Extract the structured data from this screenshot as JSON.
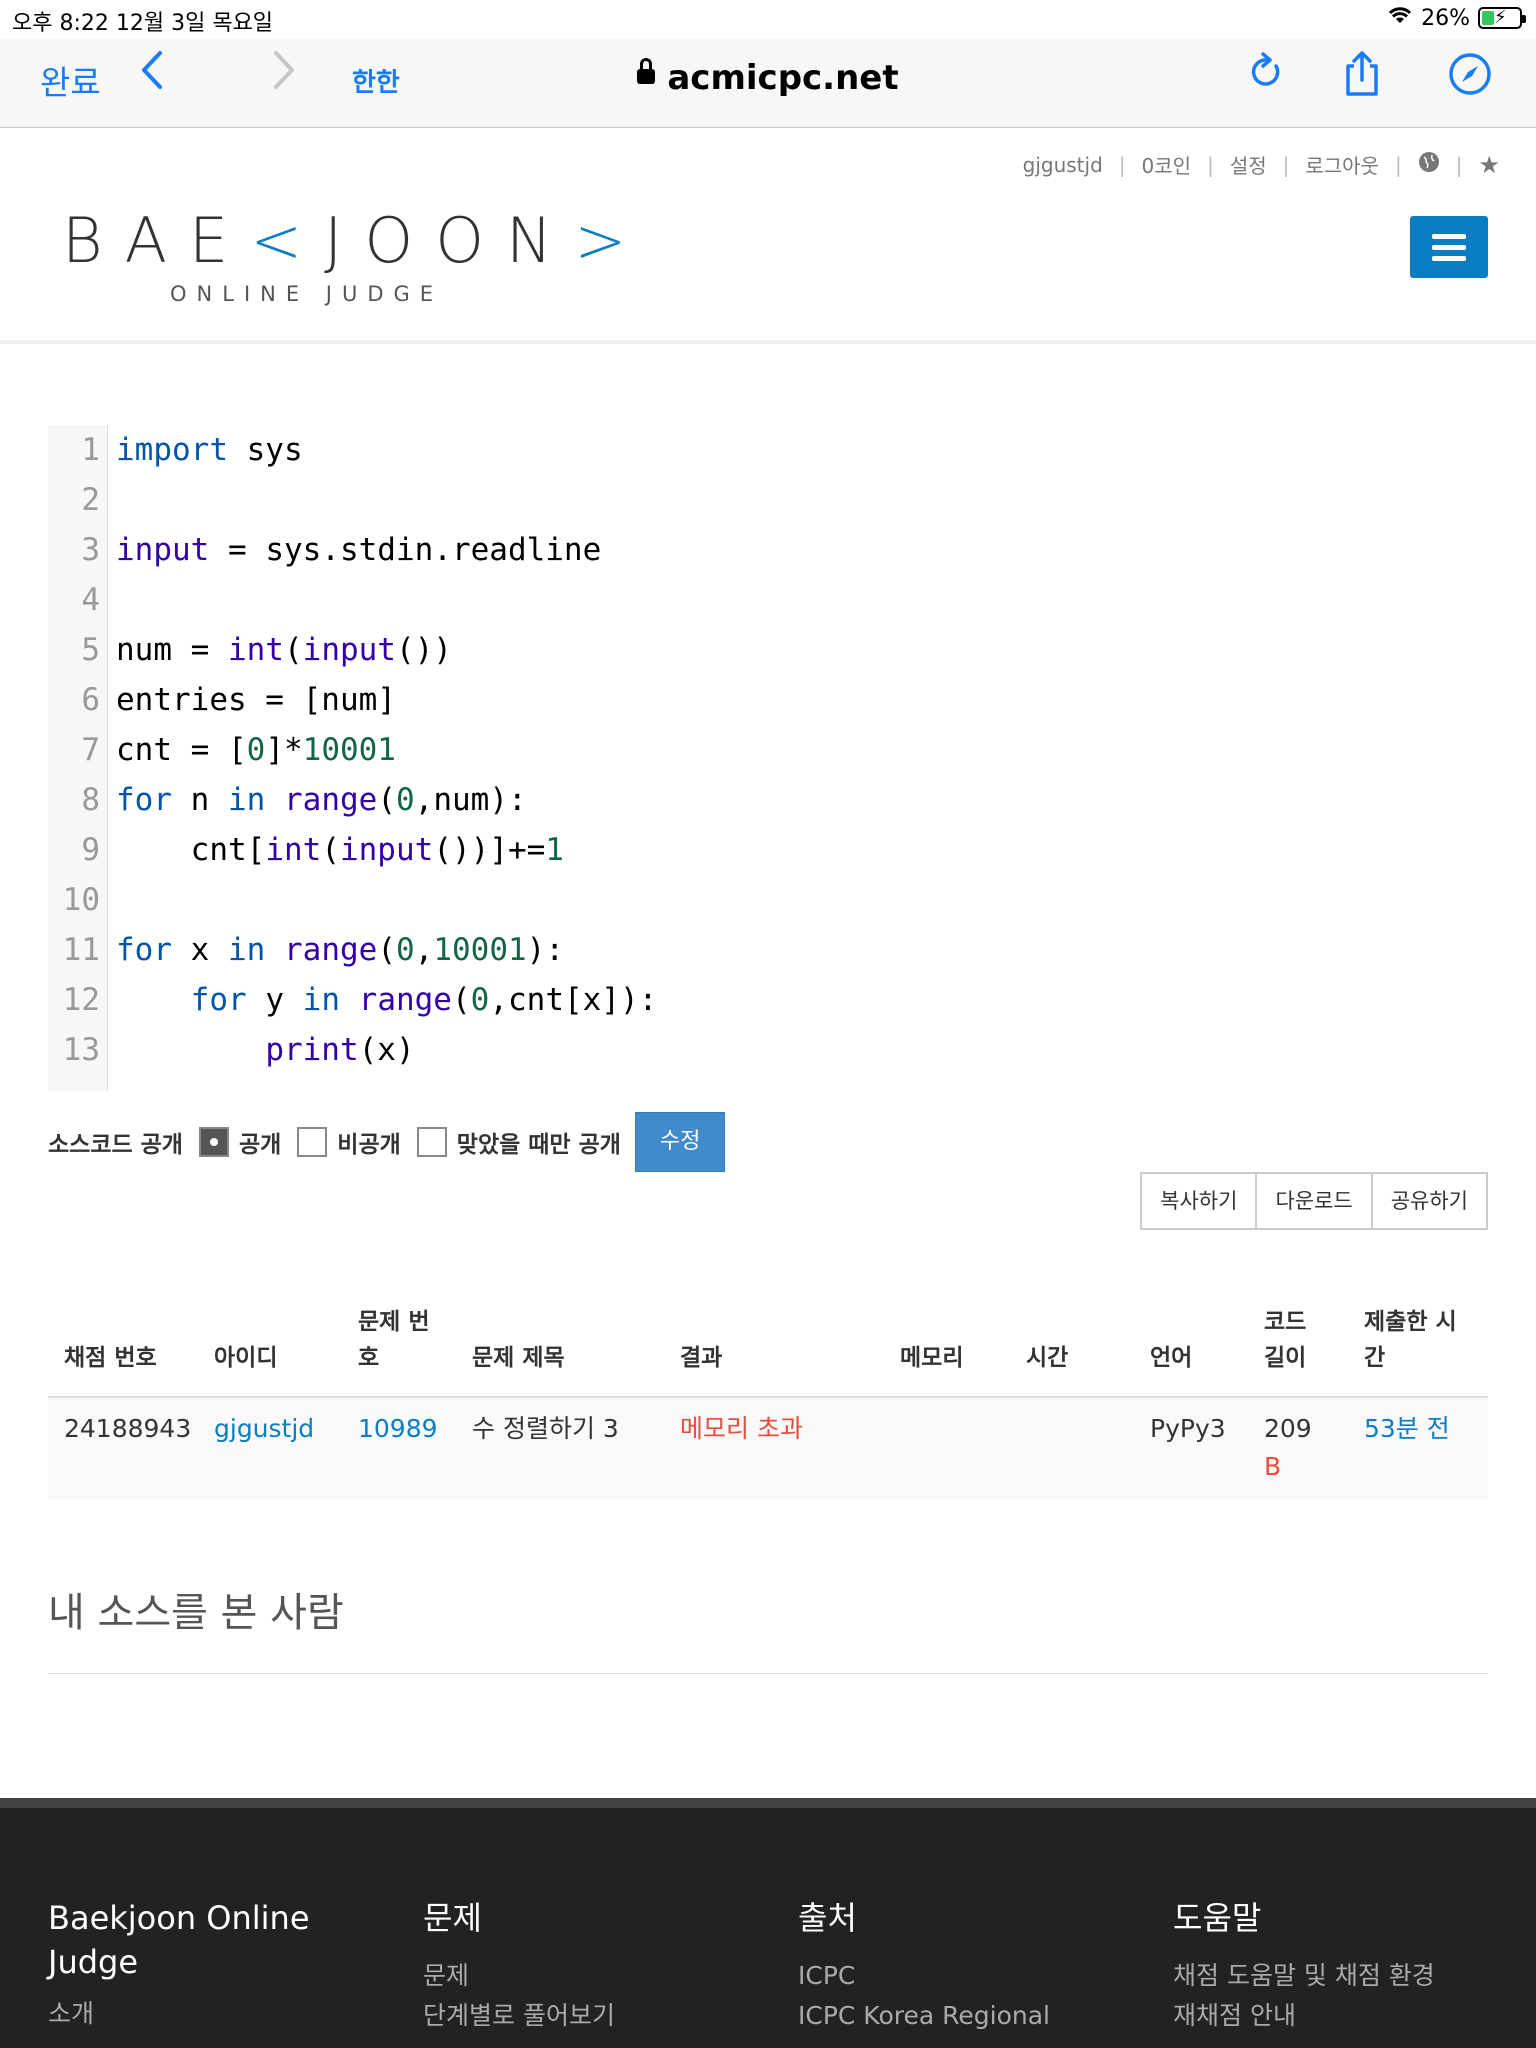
{
  "status_bar": {
    "time": "오후 8:22   12월 3일 목요일",
    "battery": "26%"
  },
  "safari": {
    "done": "완료",
    "aa": "한한",
    "url": "acmicpc.net"
  },
  "user_nav": [
    "gjgustjd",
    "0코인",
    "설정",
    "로그아웃"
  ],
  "logo": {
    "left": "BAE",
    "bracket_l": "<",
    "right": "JOON",
    "bracket_r": ">",
    "sub": "ONLINE JUDGE"
  },
  "code": {
    "line_numbers": [
      "1",
      "2",
      "3",
      "4",
      "5",
      "6",
      "7",
      "8",
      "9",
      "10",
      "11",
      "12",
      "13"
    ]
  },
  "visibility": {
    "label": "소스코드 공개",
    "options": [
      "공개",
      "비공개",
      "맞았을 때만 공개"
    ],
    "selected": "공개",
    "submit": "수정"
  },
  "actions": [
    "복사하기",
    "다운로드",
    "공유하기"
  ],
  "table": {
    "headers": {
      "id": "채점 번호",
      "user": "아이디",
      "problem_1": "문제 번",
      "problem_2": "호",
      "title": "문제 제목",
      "result": "결과",
      "memory": "메모리",
      "time": "시간",
      "lang": "언어",
      "len_1": "코드",
      "len_2": "길이",
      "submit_1": "제출한 시",
      "submit_2": "간"
    },
    "row": {
      "id": "24188943",
      "user": "gjgustjd",
      "problem": "10989",
      "title": "수 정렬하기 3",
      "result": "메모리 초과",
      "memory": "",
      "time": "",
      "lang": "PyPy3",
      "length": "209",
      "length_unit": "B",
      "submitted": "53분 전"
    }
  },
  "viewers_heading": "내 소스를 본 사람",
  "footer": {
    "col1": {
      "title": "Baekjoon Online Judge",
      "items": [
        "소개"
      ]
    },
    "col2": {
      "title": "문제",
      "items": [
        "문제",
        "단계별로 풀어보기"
      ]
    },
    "col3": {
      "title": "출처",
      "items": [
        "ICPC",
        "ICPC Korea Regional"
      ]
    },
    "col4": {
      "title": "도움말",
      "items": [
        "채점 도움말 및 채점 환경",
        "재채점 안내"
      ]
    }
  },
  "colors": {
    "brand": "#0a7ec2",
    "error": "#e74c3c",
    "button": "#428bca"
  }
}
